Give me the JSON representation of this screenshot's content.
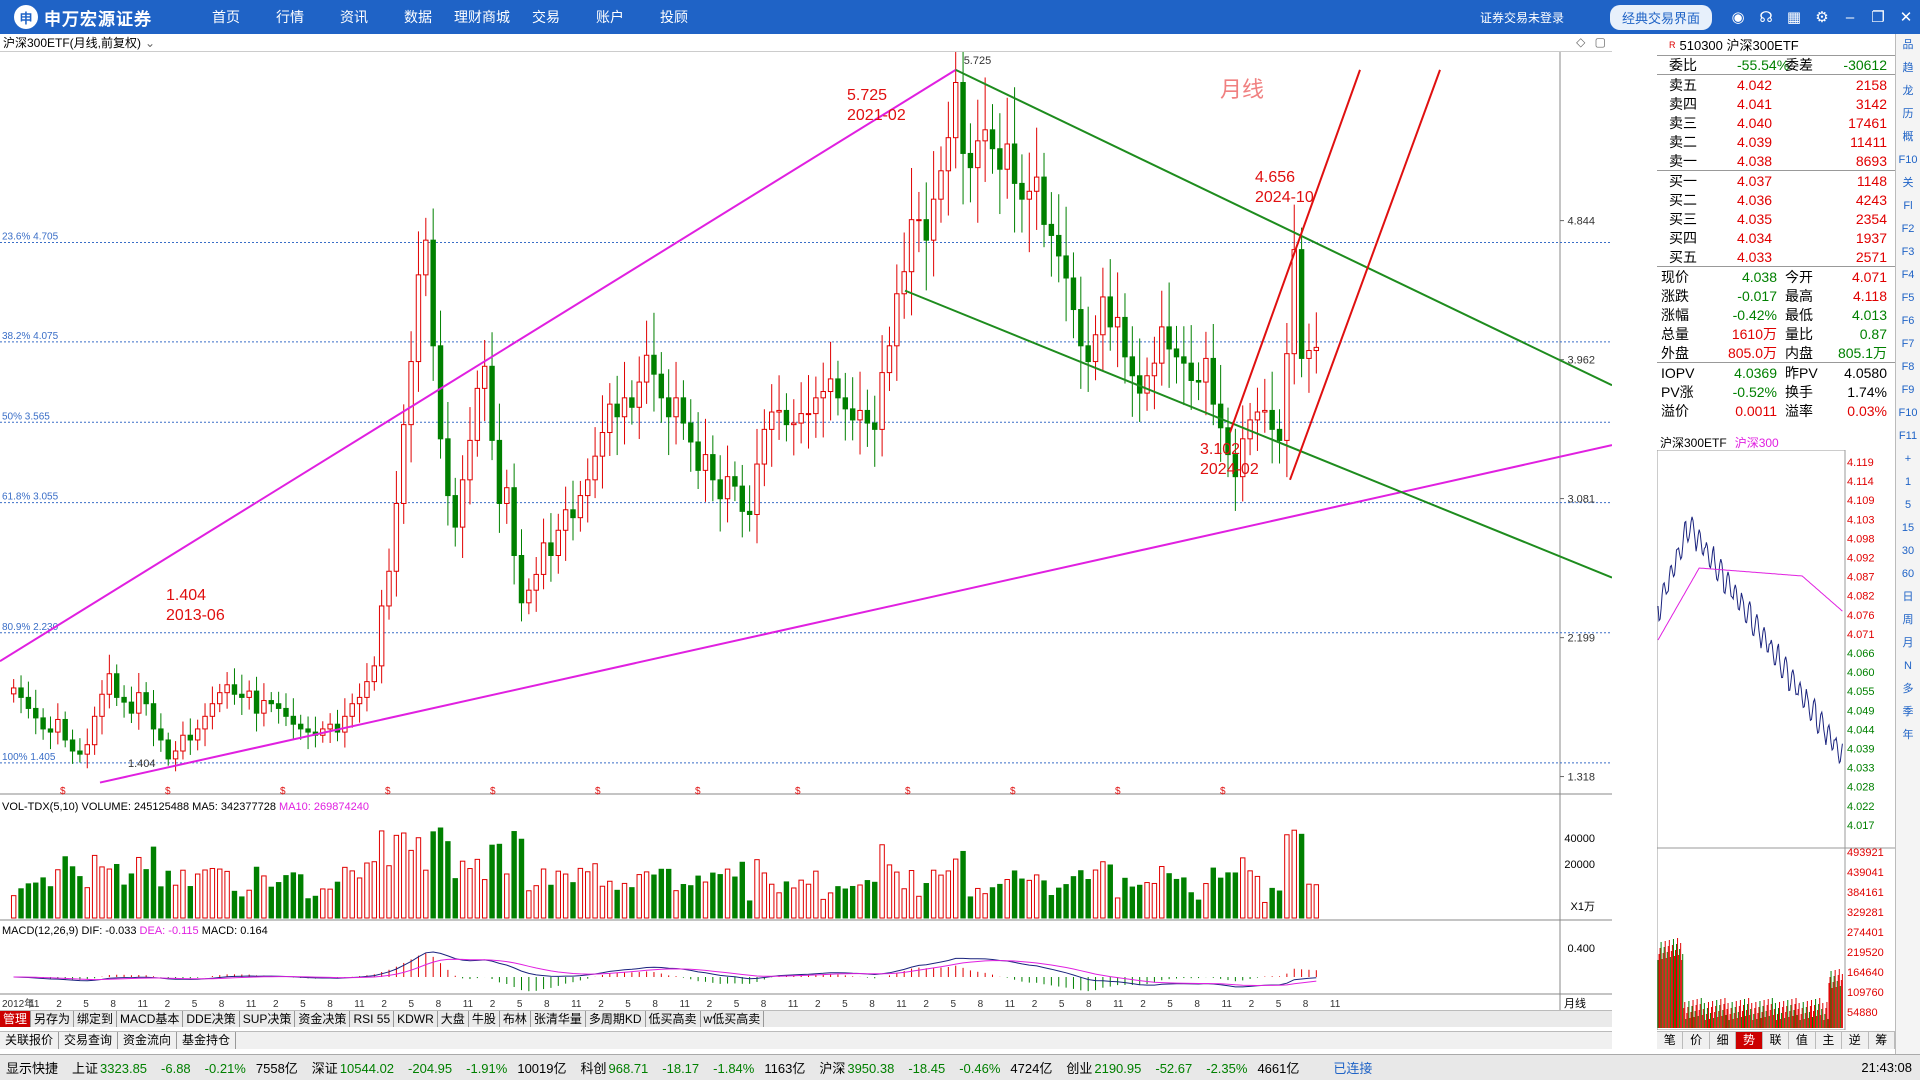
{
  "topbar": {
    "brand": "申万宏源证券",
    "nav": [
      "首页",
      "行情",
      "资讯",
      "数据",
      "理财商城",
      "交易",
      "账户",
      "投顾"
    ],
    "login_status": "证券交易未登录",
    "classic_button": "经典交易界面"
  },
  "chart_head": {
    "title": "沪深300ETF(月线,前复权)"
  },
  "chart_data": {
    "type": "candlestick",
    "period_label": "月线",
    "y_axis_labels": [
      "4.844",
      "3.962",
      "3.081",
      "2.199",
      "1.318"
    ],
    "fib_levels": [
      {
        "label": "23.6% 4.705",
        "value": 4.705
      },
      {
        "label": "38.2% 4.075",
        "value": 4.075
      },
      {
        "label": "50% 3.565",
        "value": 3.565
      },
      {
        "label": "61.8% 3.055",
        "value": 3.055
      },
      {
        "label": "80.9% 2.230",
        "value": 2.23
      },
      {
        "label": "100% 1.405",
        "value": 1.405
      }
    ],
    "annotations": [
      {
        "text": "5.725",
        "sub": "2021-02"
      },
      {
        "text": "1.404",
        "sub": "2013-06"
      },
      {
        "text": "4.656",
        "sub": "2024-10"
      },
      {
        "text": "3.102",
        "sub": "2024-02"
      }
    ],
    "high_marker": "5.725",
    "low_marker": "1.404",
    "x_axis_labels": [
      "2012年",
      "11",
      "2",
      "5",
      "8",
      "11",
      "2",
      "5",
      "8",
      "11",
      "2",
      "5",
      "8",
      "11",
      "2",
      "5",
      "8",
      "11",
      "2",
      "5",
      "8",
      "11",
      "2",
      "5",
      "8",
      "11",
      "2",
      "5",
      "8",
      "11",
      "2",
      "5",
      "8",
      "11",
      "2",
      "5",
      "8",
      "11",
      "2",
      "5",
      "8",
      "11",
      "2",
      "5",
      "8",
      "11",
      "2",
      "5",
      "8",
      "11"
    ],
    "volume_header": {
      "name": "VOL-TDX(5,10)",
      "volume": "VOLUME: 245125488",
      "ma5": "MA5: 342377728",
      "ma10": "MA10: 269874240"
    },
    "volume_axis": [
      "40000",
      "20000",
      "X1万"
    ],
    "macd_header": {
      "name": "MACD(12,26,9)",
      "dif": "DIF: -0.033",
      "dea": "DEA: -0.115",
      "macd": "MACD: 0.164"
    },
    "macd_axis": [
      "0.400"
    ],
    "closes": [
      1.88,
      1.82,
      1.75,
      1.69,
      1.62,
      1.6,
      1.68,
      1.55,
      1.48,
      1.46,
      1.52,
      1.7,
      1.84,
      1.97,
      1.82,
      1.79,
      1.72,
      1.85,
      1.78,
      1.62,
      1.55,
      1.43,
      1.48,
      1.58,
      1.55,
      1.62,
      1.7,
      1.78,
      1.85,
      1.9,
      1.84,
      1.82,
      1.86,
      1.72,
      1.8,
      1.78,
      1.75,
      1.7,
      1.65,
      1.62,
      1.6,
      1.58,
      1.62,
      1.65,
      1.6,
      1.7,
      1.78,
      1.82,
      1.92,
      2.02,
      2.4,
      2.62,
      3.05,
      3.55,
      3.95,
      4.5,
      4.72,
      4.05,
      3.46,
      3.1,
      2.9,
      3.2,
      3.45,
      3.78,
      3.92,
      3.45,
      3.05,
      3.15,
      2.72,
      2.42,
      2.5,
      2.6,
      2.8,
      2.72,
      2.88,
      3.01,
      2.96,
      3.1,
      3.2,
      3.35,
      3.5,
      3.68,
      3.6,
      3.72,
      3.66,
      3.82,
      3.99,
      3.87,
      3.72,
      3.6,
      3.72,
      3.56,
      3.44,
      3.26,
      3.36,
      3.2,
      3.08,
      3.22,
      3.16,
      3.0,
      2.98,
      3.3,
      3.52,
      3.63,
      3.64,
      3.55,
      3.56,
      3.62,
      3.62,
      3.72,
      3.76,
      3.84,
      3.72,
      3.65,
      3.58,
      3.64,
      3.56,
      3.52,
      3.88,
      4.05,
      4.38,
      4.52,
      4.85,
      4.85,
      4.72,
      4.98,
      5.16,
      5.37,
      5.72,
      5.27,
      5.18,
      5.35,
      5.42,
      5.3,
      5.17,
      5.33,
      5.08,
      4.98,
      5.03,
      5.12,
      4.82,
      4.75,
      4.62,
      4.48,
      4.28,
      4.05,
      3.95,
      4.12,
      4.36,
      4.17,
      4.23,
      3.98,
      3.86,
      3.75,
      3.86,
      3.94,
      4.17,
      4.03,
      3.98,
      3.94,
      3.83,
      3.82,
      3.97,
      3.68,
      3.53,
      3.36,
      3.22,
      3.46,
      3.58,
      3.63,
      3.64,
      3.52,
      3.45,
      4.0,
      4.66,
      3.97,
      4.02,
      4.04
    ]
  },
  "quote": {
    "code_name": "510300 沪深300ETF",
    "weibi_label": "委比",
    "weibi_value": "-55.54%",
    "weicha_label": "委差",
    "weicha_value": "-30612",
    "asks": [
      {
        "label": "卖五",
        "price": "4.042",
        "vol": "2158"
      },
      {
        "label": "卖四",
        "price": "4.041",
        "vol": "3142"
      },
      {
        "label": "卖三",
        "price": "4.040",
        "vol": "17461"
      },
      {
        "label": "卖二",
        "price": "4.039",
        "vol": "11411"
      },
      {
        "label": "卖一",
        "price": "4.038",
        "vol": "8693"
      }
    ],
    "bids": [
      {
        "label": "买一",
        "price": "4.037",
        "vol": "1148"
      },
      {
        "label": "买二",
        "price": "4.036",
        "vol": "4243"
      },
      {
        "label": "买三",
        "price": "4.035",
        "vol": "2354"
      },
      {
        "label": "买四",
        "price": "4.034",
        "vol": "1937"
      },
      {
        "label": "买五",
        "price": "4.033",
        "vol": "2571"
      }
    ],
    "stats": [
      {
        "l1": "现价",
        "v1": "4.038",
        "c1": "green",
        "l2": "今开",
        "v2": "4.071",
        "c2": "red"
      },
      {
        "l1": "涨跌",
        "v1": "-0.017",
        "c1": "green",
        "l2": "最高",
        "v2": "4.118",
        "c2": "red"
      },
      {
        "l1": "涨幅",
        "v1": "-0.42%",
        "c1": "green",
        "l2": "最低",
        "v2": "4.013",
        "c2": "green"
      },
      {
        "l1": "总量",
        "v1": "1610万",
        "c1": "red",
        "l2": "量比",
        "v2": "0.87",
        "c2": "green"
      },
      {
        "l1": "外盘",
        "v1": "805.0万",
        "c1": "red",
        "l2": "内盘",
        "v2": "805.1万",
        "c2": "green"
      }
    ],
    "iopv": [
      {
        "l1": "IOPV",
        "v1": "4.0369",
        "c1": "green",
        "l2": "昨PV",
        "v2": "4.0580",
        "c2": "black"
      },
      {
        "l1": "PV涨",
        "v1": "-0.52%",
        "c1": "green",
        "l2": "换手",
        "v2": "1.74%",
        "c2": "black"
      },
      {
        "l1": "溢价",
        "v1": "0.0011",
        "c1": "red",
        "l2": "溢率",
        "v2": "0.03%",
        "c2": "red"
      }
    ]
  },
  "intraday": {
    "tabs": [
      "沪深300ETF",
      "沪深300"
    ],
    "price_axis": [
      "4.119",
      "4.114",
      "4.109",
      "4.103",
      "4.098",
      "4.092",
      "4.087",
      "4.082",
      "4.076",
      "4.071",
      "4.066",
      "4.060",
      "4.055",
      "4.049",
      "4.044",
      "4.039",
      "4.033",
      "4.028",
      "4.022",
      "4.017"
    ],
    "vol_axis": [
      "493921",
      "439041",
      "384161",
      "329281",
      "274401",
      "219520",
      "164640",
      "109760",
      "54880"
    ]
  },
  "side_icons": [
    "品",
    "趋",
    "龙",
    "历",
    "概",
    "F10",
    "关",
    "Fl",
    "F2",
    "F3",
    "F4",
    "F5",
    "F6",
    "F7",
    "F8",
    "F9",
    "F10",
    "F11",
    "+",
    "1",
    "5",
    "15",
    "30",
    "60",
    "日",
    "周",
    "月",
    "N",
    "多",
    "季",
    "年"
  ],
  "indicator_bar": [
    "管理",
    "另存为",
    "绑定到",
    "MACD基本",
    "DDE决策",
    "SUP决策",
    "资金决策",
    "RSI 55",
    "KDWR",
    "大盘",
    "牛股",
    "布林",
    "张清华量",
    "多周期KD",
    "低买高卖",
    "w低买高卖"
  ],
  "page_tabs": [
    "关联报价",
    "交易查询",
    "资金流向",
    "基金持仓"
  ],
  "right_tabs": [
    "笔",
    "价",
    "细",
    "势",
    "联",
    "值",
    "主",
    "逆",
    "筹"
  ],
  "period_tag": "月线",
  "statusbar": {
    "display_label": "显示快捷",
    "indices": [
      {
        "name": "上证",
        "value": "3323.85",
        "chg": "-6.88",
        "pct": "-0.21%",
        "amt": "7558亿"
      },
      {
        "name": "深证",
        "value": "10544.02",
        "chg": "-204.95",
        "pct": "-1.91%",
        "amt": "10019亿"
      },
      {
        "name": "科创",
        "value": "968.71",
        "chg": "-18.17",
        "pct": "-1.84%",
        "amt": "1163亿"
      },
      {
        "name": "沪深",
        "value": "3950.38",
        "chg": "-18.45",
        "pct": "-0.46%",
        "amt": "4724亿"
      },
      {
        "name": "创业",
        "value": "2190.95",
        "chg": "-52.67",
        "pct": "-2.35%",
        "amt": "4661亿"
      }
    ],
    "connection": "已连接",
    "time": "21:43:08"
  },
  "colors": {
    "up": "#e00000",
    "down": "#008000",
    "magenta": "#e020e0",
    "brand": "#1f63c6"
  }
}
